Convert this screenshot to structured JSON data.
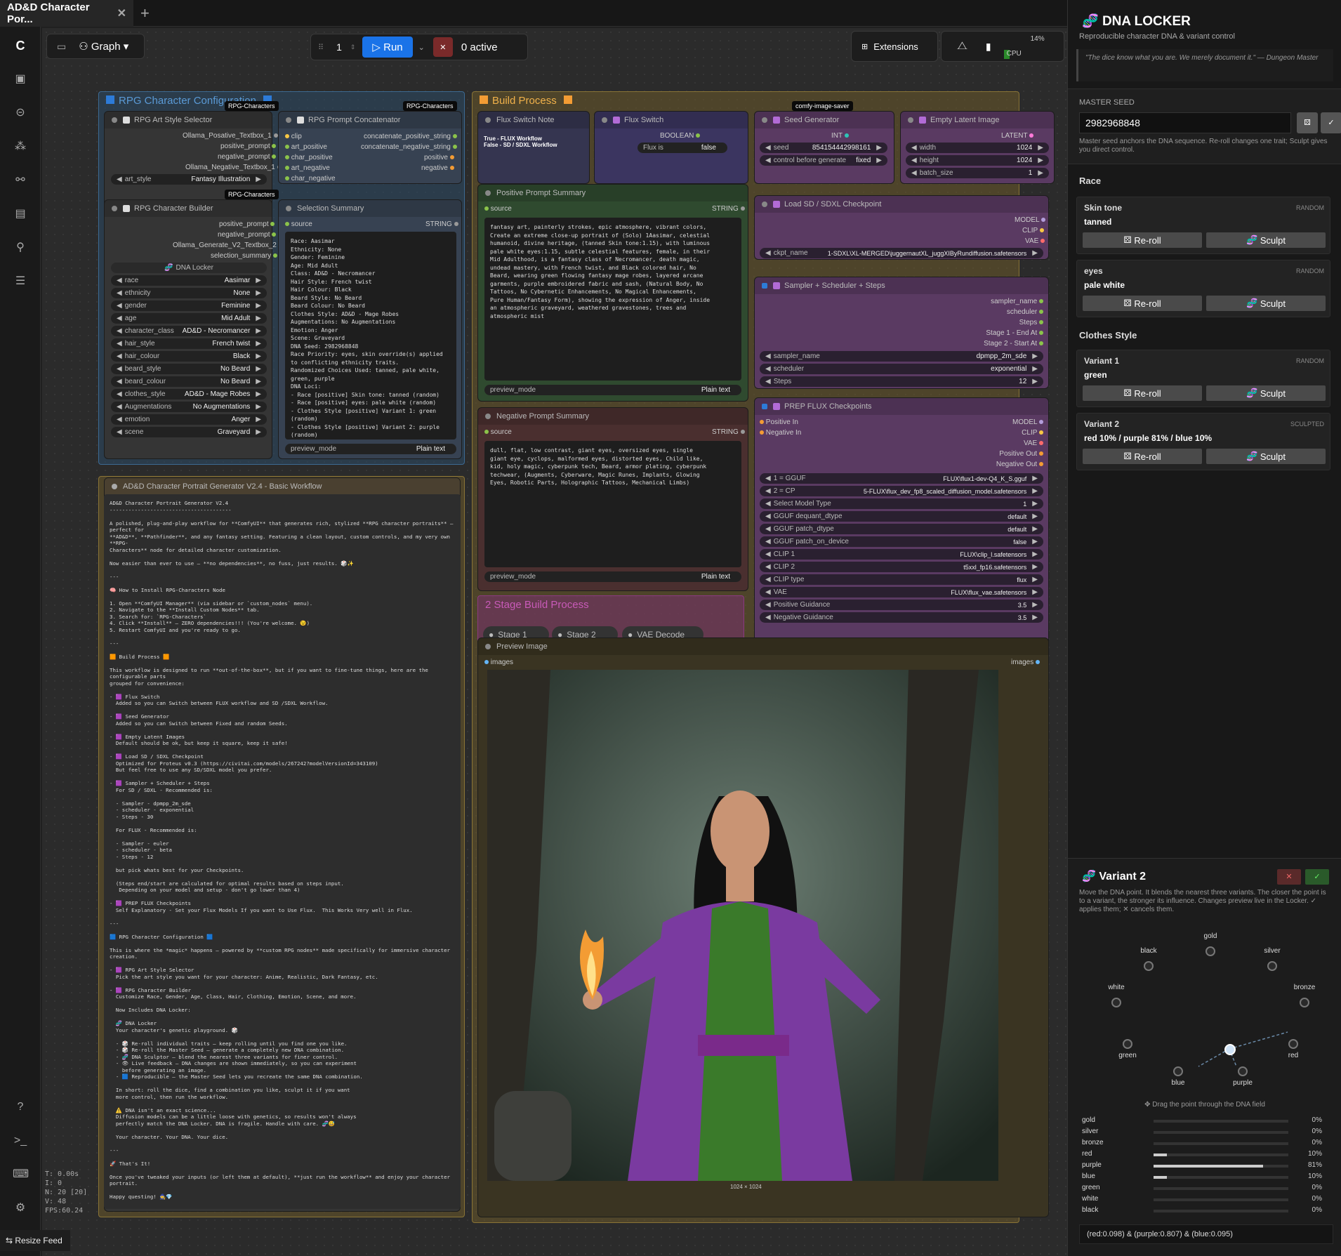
{
  "tab": {
    "title": "AD&D Character Por...",
    "close": "✕",
    "new": "+"
  },
  "toolbar": {
    "graph_label": "Graph",
    "queue_count": "1",
    "run_label": "Run",
    "active_label": "0 active",
    "extensions_label": "Extensions",
    "cpu_label": "CPU",
    "cpu_pct": "14%",
    "cpu_level": 0.14
  },
  "stats": [
    "T: 0.00s",
    "I: 0",
    "N: 20 [20]",
    "V: 48",
    "FPS:60.24"
  ],
  "resize_feed": "Resize Feed",
  "groups": {
    "rpg_config": "RPG Character Configuration",
    "build": "Build Process",
    "basic": "AD&D Character Portrait Generator V2.4 - Basic Workflow",
    "stage2": "2 Stage Build Process"
  },
  "badges": {
    "rpg1": "RPG-Characters",
    "rpg2": "RPG-Characters",
    "rpg3": "RPG-Characters",
    "saver": "comfy-image-saver"
  },
  "art_style": {
    "title": "RPG Art Style Selector",
    "outputs": [
      "Ollama_Posative_Textbox_1",
      "positive_prompt",
      "negative_prompt",
      "Ollama_Negative_Textbox_1"
    ],
    "widget_label": "art_style",
    "widget_value": "Fantasy Illustration"
  },
  "concat": {
    "title": "RPG Prompt Concatenator",
    "inputs": [
      "clip",
      "art_positive",
      "char_positive",
      "art_negative",
      "char_negative"
    ],
    "outputs": [
      "concatenate_positive_string",
      "concatenate_negative_string",
      "positive",
      "negative"
    ]
  },
  "builder": {
    "title": "RPG Character Builder",
    "outputs": [
      "positive_prompt",
      "negative_prompt",
      "Ollama_Generate_V2_Textbox_2",
      "selection_summary"
    ],
    "dna_label": "DNA Locker",
    "widgets": [
      {
        "k": "race",
        "v": "Aasimar"
      },
      {
        "k": "ethnicity",
        "v": "None"
      },
      {
        "k": "gender",
        "v": "Feminine"
      },
      {
        "k": "age",
        "v": "Mid Adult"
      },
      {
        "k": "character_class",
        "v": "AD&D - Necromancer"
      },
      {
        "k": "hair_style",
        "v": "French twist"
      },
      {
        "k": "hair_colour",
        "v": "Black"
      },
      {
        "k": "beard_style",
        "v": "No Beard"
      },
      {
        "k": "beard_colour",
        "v": "No Beard"
      },
      {
        "k": "clothes_style",
        "v": "AD&D - Mage Robes"
      },
      {
        "k": "Augmentations",
        "v": "No Augmentations"
      },
      {
        "k": "emotion",
        "v": "Anger"
      },
      {
        "k": "scene",
        "v": "Graveyard"
      }
    ]
  },
  "selection": {
    "title": "Selection Summary",
    "input": "source",
    "type": "STRING",
    "mode_label": "preview_mode",
    "mode_value": "Plain text",
    "text": "Race: Aasimar\nEthnicity: None\nGender: Feminine\nAge: Mid Adult\nClass: AD&D - Necromancer\nHair Style: French twist\nHair Colour: Black\nBeard Style: No Beard\nBeard Colour: No Beard\nClothes Style: AD&D - Mage Robes\nAugmentations: No Augmentations\nEmotion: Anger\nScene: Graveyard\nDNA Seed: 2982968848\nRace Priority: eyes, skin override(s) applied\nto conflicting ethnicity traits.\nRandomized Choices Used: tanned, pale white,\ngreen, purple\nDNA Loci:\n- Race [positive] Skin tone: tanned (random)\n- Race [positive] eyes: pale white (random)\n- Clothes Style [positive] Variant 1: green\n(random)\n- Clothes Style [positive] Variant 2: purple\n(random)"
  },
  "flux_note": {
    "title": "Flux Switch Note",
    "text": "True - FLUX Workflow\nFalse - SD / SDXL Workflow"
  },
  "flux_switch": {
    "title": "Flux Switch",
    "out": "BOOLEAN",
    "label": "Flux is",
    "value": "false"
  },
  "seed": {
    "title": "Seed Generator",
    "out": "INT",
    "w1k": "seed",
    "w1v": "854154442998161",
    "w2k": "control before generate",
    "w2v": "fixed"
  },
  "latent": {
    "title": "Empty Latent Image",
    "out": "LATENT",
    "widgets": [
      {
        "k": "width",
        "v": "1024"
      },
      {
        "k": "height",
        "v": "1024"
      },
      {
        "k": "batch_size",
        "v": "1"
      }
    ]
  },
  "pos_summary": {
    "title": "Positive Prompt Summary",
    "input": "source",
    "type": "STRING",
    "mode_label": "preview_mode",
    "mode_value": "Plain text",
    "text": "fantasy art, painterly strokes, epic atmosphere, vibrant colors,\nCreate an extreme close-up portrait of (Solo) 1Aasimar, celestial\nhumanoid, divine heritage, (tanned Skin tone:1.15), with luminous\npale white eyes:1.15, subtle celestial features, female, in their\nMid Adulthood, is a fantasy class of Necromancer, death magic,\nundead mastery, with French twist, and Black colored hair, No\nBeard, wearing green flowing fantasy mage robes, layered arcane\ngarments, purple embroidered fabric and sash, (Natural Body, No\nTattoos, No Cybernetic Enhancements, No Magical Enhancements,\nPure Human/Fantasy Form), showing the expression of Anger, inside\nan atmospheric graveyard, weathered gravestones, trees and\natmospheric mist"
  },
  "neg_summary": {
    "title": "Negative Prompt Summary",
    "input": "source",
    "type": "STRING",
    "mode_label": "preview_mode",
    "mode_value": "Plain text",
    "text": "dull, flat, low contrast, giant eyes, oversized eyes, single\ngiant eye, cyclops, malformed eyes, distorted eyes, Child like,\nkid, holy magic, cyberpunk tech, Beard, armor plating, cyberpunk\ntechwear, (Augments, Cyberware, Magic Runes, Implants, Glowing\nEyes, Robotic Parts, Holographic Tattoos, Mechanical Limbs)"
  },
  "checkpoint": {
    "title": "Load SD / SDXL Checkpoint",
    "outputs": [
      "MODEL",
      "CLIP",
      "VAE"
    ],
    "wk": "ckpt_name",
    "wv": "1-SDXL\\XL-MERGED\\juggernautXL_juggXIByRundiffusion.safetensors"
  },
  "sampler": {
    "title": "Sampler + Scheduler + Steps",
    "outputs": [
      "sampler_name",
      "scheduler",
      "Steps",
      "Stage 1 - End At",
      "Stage 2 - Start At"
    ],
    "widgets": [
      {
        "k": "sampler_name",
        "v": "dpmpp_2m_sde"
      },
      {
        "k": "scheduler",
        "v": "exponential"
      },
      {
        "k": "Steps",
        "v": "12"
      }
    ]
  },
  "prep": {
    "title": "PREP FLUX Checkpoints",
    "inputs": [
      "Positive In",
      "Negative In"
    ],
    "outputs": [
      "MODEL",
      "CLIP",
      "VAE",
      "Positive Out",
      "Negative Out"
    ],
    "widgets": [
      {
        "k": "1 = GGUF",
        "v": "FLUX\\flux1-dev-Q4_K_S.gguf"
      },
      {
        "k": "2 = CP",
        "v": "5-FLUX\\flux_dev_fp8_scaled_diffusion_model.safetensors"
      },
      {
        "k": "Select Model Type",
        "v": "1"
      },
      {
        "k": "GGUF dequant_dtype",
        "v": "default"
      },
      {
        "k": "GGUF patch_dtype",
        "v": "default"
      },
      {
        "k": "GGUF patch_on_device",
        "v": "false"
      },
      {
        "k": "CLIP 1",
        "v": "FLUX\\clip_l.safetensors"
      },
      {
        "k": "CLIP 2",
        "v": "t5xxl_fp16.safetensors"
      },
      {
        "k": "CLIP type",
        "v": "flux"
      },
      {
        "k": "VAE",
        "v": "FLUX\\flux_vae.safetensors"
      },
      {
        "k": "Positive Guidance",
        "v": "3.5"
      },
      {
        "k": "Negative Guidance",
        "v": "3.5"
      }
    ]
  },
  "stages": [
    "Stage 1",
    "Stage 2",
    "VAE Decode"
  ],
  "preview": {
    "title": "Preview Image",
    "input": "images",
    "output": "images",
    "size": "1024 × 1024"
  },
  "notes_text": "AD&D Character Portrait Generator V2.4\n---------------------------------------\n\nA polished, plug-and-play workflow for **ComfyUI** that generates rich, stylized **RPG character portraits** — perfect for\n**AD&D**, **Pathfinder**, and any fantasy setting. Featuring a clean layout, custom controls, and my very own **RPG-\nCharacters** node for detailed character customization.\n\nNow easier than ever to use — **no dependencies**, no fuss, just results. 🎲✨\n\n---\n\n🧠 How to Install RPG-Characters Node\n\n1. Open **ComfyUI Manager** (via sidebar or `custom_nodes` menu).\n2. Navigate to the **Install Custom Nodes** tab.\n3. Search for: `RPG-Characters`\n4. Click **Install** — ZERO dependencies!!! (You're welcome. 😉)\n5. Restart ComfyUI and you're ready to go.\n\n---\n\n🟧 Build Process 🟧\n\nThis workflow is designed to run **out-of-the-box**, but if you want to fine-tune things, here are the configurable parts\ngrouped for convenience:\n\n- 🟪 Flux Switch\n  Added so you can Switch between FLUX workflow and SD /SDXL Workflow.\n\n- 🟪 Seed Generator\n  Added so you can Switch between Fixed and random Seeds.\n\n- 🟪 Empty Latent Images\n  Default should be ok, but keep it square, keep it safe!\n\n- 🟪 Load SD / SDXL Checkpoint\n  Optimized for Proteus v0.3 (https://civitai.com/models/267242?modelVersionId=343109)\n  But feel free to use any SD/SDXL model you prefer.\n\n- 🟪 Sampler + Scheduler + Steps\n  For SD / SDXL - Recommended is:\n\n  - Sampler - dpmpp_2m_sde\n  - scheduler - exponential\n  - Steps - 30\n\n  For FLUX - Recommended is:\n\n  - Sampler - euler\n  - scheduler - beta\n  - Steps - 12\n\n  but pick whats best for your Checkpoints.\n\n  (Steps end/start are calculated for optimal results based on steps input.\n   Depending on your model and setup - don't go lower than 4)\n\n- 🟪 PREP FLUX Checkpoints\n  Self Explanatory - Set your Flux Models If you want to Use Flux.  This Works Very well in Flux.\n\n---\n\n🟦 RPG Character Configuration 🟦\n\nThis is where the *magic* happens — powered by **custom RPG nodes** made specifically for immersive character creation.\n\n- 🟪 RPG Art Style Selector\n  Pick the art style you want for your character: Anime, Realistic, Dark Fantasy, etc.\n\n- 🟪 RPG Character Builder\n  Customize Race, Gender, Age, Class, Hair, Clothing, Emotion, Scene, and more.\n\n  Now Includes DNA Locker:\n\n  🧬 DNA Locker\n  Your character's genetic playground. 🎲\n\n  - 🎲 Re-roll individual traits — keep rolling until you find one you like.\n  - 🎲 Re-roll the Master Seed — generate a completely new DNA combination.\n  - 🧬 DNA Sculptor — blend the nearest three variants for finer control.\n  - 👁 Live feedback — DNA changes are shown immediately, so you can experiment\n    before generating an image.\n  - 🟦 Reproducible — the Master Seed lets you recreate the same DNA combination.\n\n  In short: roll the dice, find a combination you like, sculpt it if you want\n  more control, then run the workflow.\n\n  ⚠️ DNA isn't an exact science...\n  Diffusion models can be a little loose with genetics, so results won't always\n  perfectly match the DNA Locker. DNA is fragile. Handle with care. 🧬😅\n\n  Your character. Your DNA. Your dice.\n\n---\n\n🚀 That's It!\n\nOnce you've tweaked your inputs (or left them at default), **just run the workflow** and enjoy your character portrait.\n\nHappy questing! 🧙💎",
  "panel": {
    "title": "DNA LOCKER",
    "subtitle": "Reproducible character DNA & variant control",
    "quote": "\"The dice know what you are. We merely document it.\" — Dungeon Master",
    "seed_label": "MASTER SEED",
    "seed_value": "2982968848",
    "seed_help": "Master seed anchors the DNA sequence. Re-roll changes one trait; Sculpt gives you direct control.",
    "race_heading": "Race",
    "clothes_heading": "Clothes Style",
    "reroll_label": "Re-roll",
    "sculpt_label": "Sculpt",
    "traits": [
      {
        "name": "Skin tone",
        "tag": "RANDOM",
        "value": "tanned"
      },
      {
        "name": "eyes",
        "tag": "RANDOM",
        "value": "pale white"
      },
      {
        "name": "Variant 1",
        "tag": "RANDOM",
        "value": "green"
      },
      {
        "name": "Variant 2",
        "tag": "SCULPTED",
        "value": "red 10% / purple 81% / blue 10%"
      }
    ],
    "sculpt": {
      "title": "Variant 2",
      "help": "Move the DNA point. It blends the nearest three variants. The closer the point is to a variant, the stronger its influence. Changes preview live in the Locker. ✓ applies them; ✕ cancels them.",
      "drag_hint": "Drag the point through the DNA field",
      "points": [
        "black",
        "gold",
        "silver",
        "white",
        "bronze",
        "green",
        "blue",
        "purple",
        "red"
      ],
      "bars": [
        {
          "name": "gold",
          "pct": "0%",
          "v": 0
        },
        {
          "name": "silver",
          "pct": "0%",
          "v": 0
        },
        {
          "name": "bronze",
          "pct": "0%",
          "v": 0
        },
        {
          "name": "red",
          "pct": "10%",
          "v": 0.1
        },
        {
          "name": "purple",
          "pct": "81%",
          "v": 0.81
        },
        {
          "name": "blue",
          "pct": "10%",
          "v": 0.1
        },
        {
          "name": "green",
          "pct": "0%",
          "v": 0
        },
        {
          "name": "white",
          "pct": "0%",
          "v": 0
        },
        {
          "name": "black",
          "pct": "0%",
          "v": 0
        }
      ],
      "formula": "(red:0.098) & (purple:0.807) & (blue:0.095)"
    }
  },
  "colors": {
    "accent": "#1a73e8",
    "rpg_group": "#2c4a66",
    "build_group": "#6b5a2a",
    "purple_node": "#5a3a62",
    "green_node": "#2f4a2f",
    "red_node": "#4a2f2f"
  }
}
